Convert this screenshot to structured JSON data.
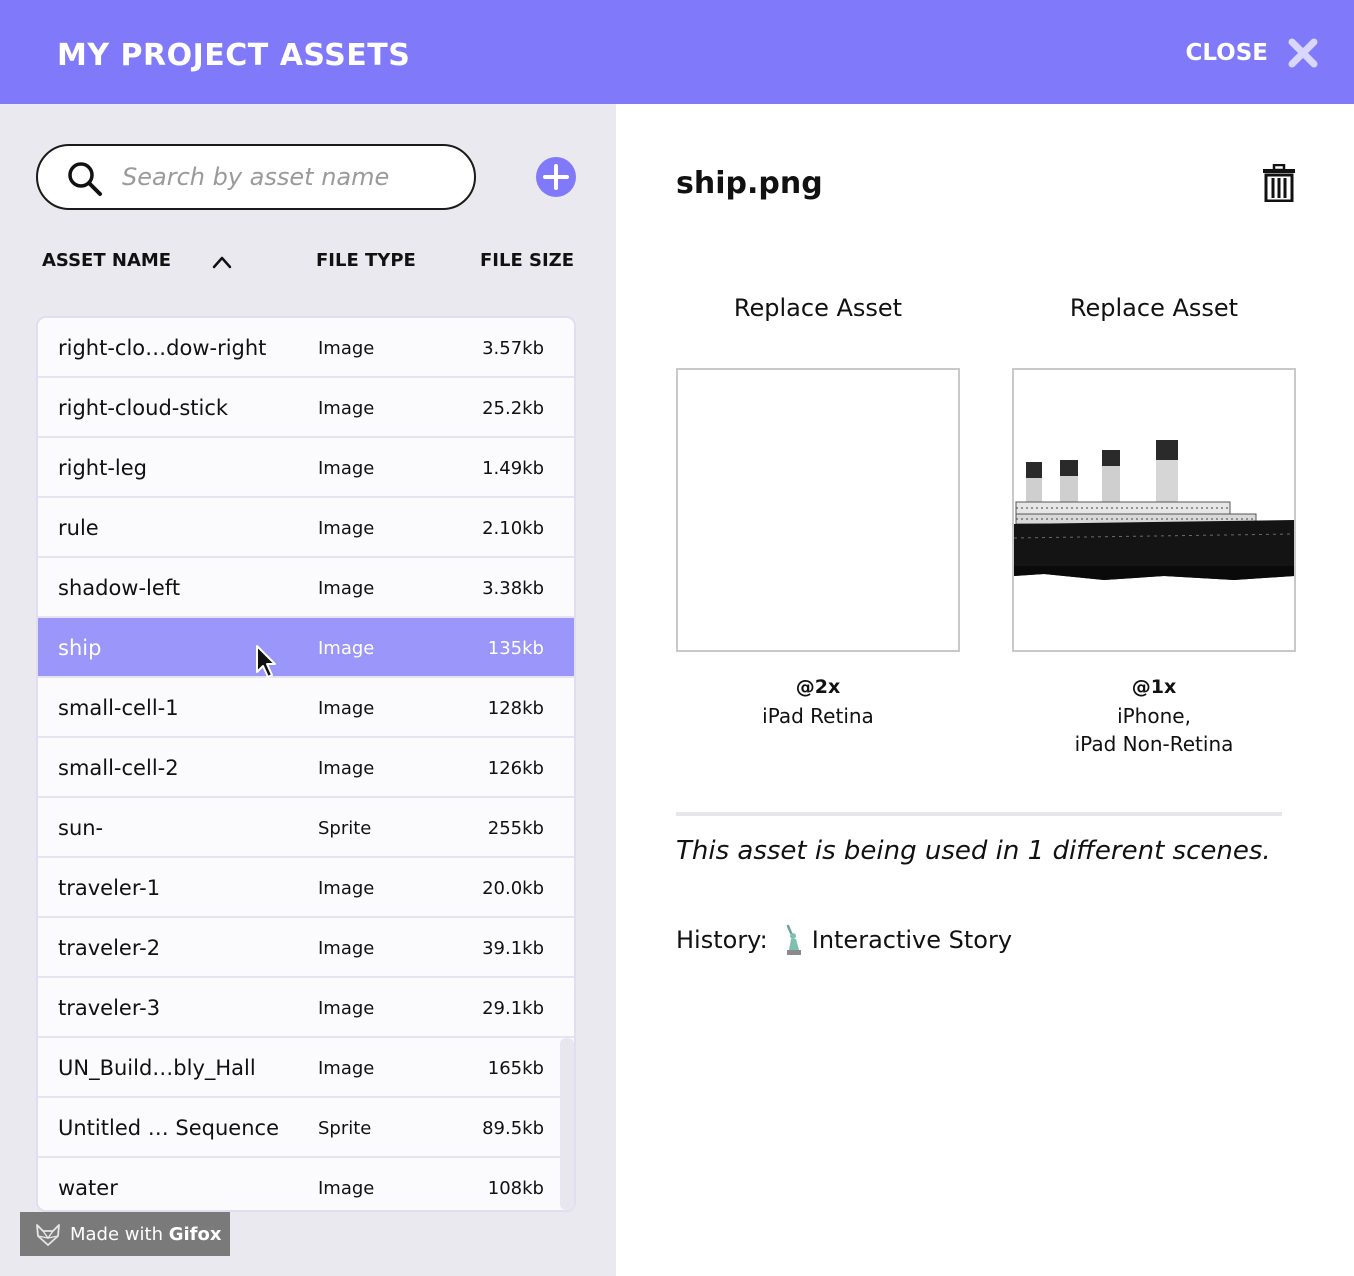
{
  "header": {
    "title": "MY PROJECT ASSETS",
    "close_label": "CLOSE",
    "bg_color": "#8079fa"
  },
  "sidebar": {
    "search_placeholder": "Search by asset name",
    "search_value": "",
    "columns": {
      "name": "ASSET NAME",
      "type": "FILE TYPE",
      "size": "FILE SIZE"
    },
    "sort": "ascending",
    "assets": [
      {
        "name": "right-clo…dow-right",
        "type": "Image",
        "size": "3.57kb"
      },
      {
        "name": "right-cloud-stick",
        "type": "Image",
        "size": "25.2kb"
      },
      {
        "name": "right-leg",
        "type": "Image",
        "size": "1.49kb"
      },
      {
        "name": "rule",
        "type": "Image",
        "size": "2.10kb"
      },
      {
        "name": "shadow-left",
        "type": "Image",
        "size": "3.38kb"
      },
      {
        "name": "ship",
        "type": "Image",
        "size": "135kb",
        "selected": true
      },
      {
        "name": "small-cell-1",
        "type": "Image",
        "size": "128kb"
      },
      {
        "name": "small-cell-2",
        "type": "Image",
        "size": "126kb"
      },
      {
        "name": "sun-",
        "type": "Sprite",
        "size": "255kb"
      },
      {
        "name": "traveler-1",
        "type": "Image",
        "size": "20.0kb"
      },
      {
        "name": "traveler-2",
        "type": "Image",
        "size": "39.1kb"
      },
      {
        "name": "traveler-3",
        "type": "Image",
        "size": "29.1kb"
      },
      {
        "name": "UN_Build…bly_Hall",
        "type": "Image",
        "size": "165kb"
      },
      {
        "name": "Untitled … Sequence",
        "type": "Sprite",
        "size": "89.5kb"
      },
      {
        "name": "water",
        "type": "Image",
        "size": "108kb"
      }
    ],
    "selected_color": "#9a96fa"
  },
  "detail": {
    "title": "ship.png",
    "variants": [
      {
        "replace_label": "Replace Asset",
        "scale": "@2x",
        "devices": "iPad Retina",
        "has_image": false
      },
      {
        "replace_label": "Replace Asset",
        "scale": "@1x",
        "devices": "iPhone,\niPad Non-Retina",
        "has_image": true
      }
    ],
    "usage_text": "This asset is being used in 1 different scenes.",
    "history_label": "History:",
    "history_link": "Interactive Story"
  },
  "watermark": {
    "prefix": "Made with",
    "brand": "Gifox"
  }
}
